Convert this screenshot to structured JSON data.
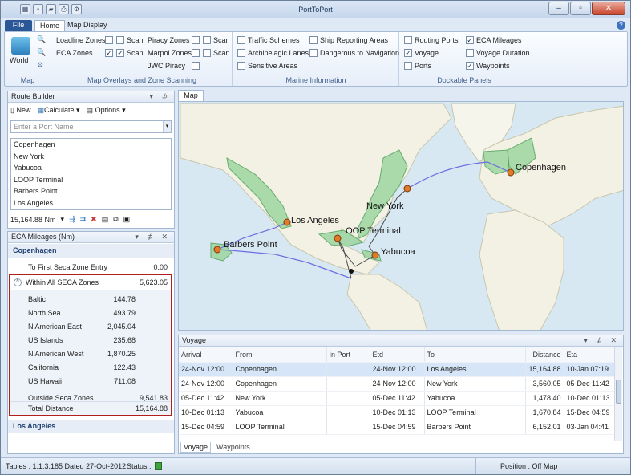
{
  "app": {
    "title": "PortToPort"
  },
  "tabs": {
    "file": "File",
    "home": "Home",
    "map_display": "Map Display"
  },
  "ribbon": {
    "map_group": {
      "world": "World",
      "name": "Map"
    },
    "overlays": {
      "name": "Map Overlays and Zone Scanning",
      "loadline": "Loadline Zones",
      "eca": "ECA Zones",
      "piracy": "Piracy Zones",
      "marpol": "Marpol Zones",
      "jwc": "JWC Piracy",
      "scan": "Scan"
    },
    "marine": {
      "name": "Marine Information",
      "traffic": "Traffic Schemes",
      "archipelagic": "Archipelagic Lanes",
      "sensitive": "Sensitive Areas",
      "ship_reporting": "Ship Reporting Areas",
      "dangerous": "Dangerous to Navigation"
    },
    "dockable": {
      "name": "Dockable Panels",
      "routing_ports": "Routing Ports",
      "voyage": "Voyage",
      "ports": "Ports",
      "eca_mileages": "ECA Mileages",
      "voyage_duration": "Voyage Duration",
      "waypoints": "Waypoints"
    }
  },
  "route_builder": {
    "title": "Route Builder",
    "new": "New",
    "calculate": "Calculate",
    "options": "Options",
    "placeholder": "Enter a Port Name",
    "ports": [
      "Copenhagen",
      "New York",
      "Yabucoa",
      "LOOP Terminal",
      "Barbers Point",
      "Los Angeles"
    ],
    "distance": "15,164.88 Nm"
  },
  "eca": {
    "title": "ECA Mileages (Nm)",
    "origin": "Copenhagen",
    "first_entry_label": "To First Seca Zone Entry",
    "first_entry_value": "0.00",
    "within_label": "Within All SECA Zones",
    "within_value": "5,623.05",
    "zones": [
      {
        "name": "Baltic",
        "value": "144.78"
      },
      {
        "name": "North Sea",
        "value": "493.79"
      },
      {
        "name": "N American East",
        "value": "2,045.04"
      },
      {
        "name": "US Islands",
        "value": "235.68"
      },
      {
        "name": "N American West",
        "value": "1,870.25"
      },
      {
        "name": "California",
        "value": "122.43"
      },
      {
        "name": "US Hawaii",
        "value": "711.08"
      }
    ],
    "outside_label": "Outside Seca Zones",
    "outside_value": "9,541.83",
    "total_label": "Total Distance",
    "total_value": "15,164.88",
    "destination": "Los Angeles"
  },
  "map": {
    "tab": "Map",
    "labels": {
      "copenhagen": "Copenhagen",
      "new_york": "New York",
      "los_angeles": "Los Angeles",
      "loop": "LOOP Terminal",
      "barbers": "Barbers Point",
      "yabucoa": "Yabucoa"
    }
  },
  "voyage": {
    "title": "Voyage",
    "columns": [
      "Arrival",
      "From",
      "In Port",
      "Etd",
      "To",
      "Distance",
      "Eta"
    ],
    "rows": [
      [
        "24-Nov 12:00",
        "Copenhagen",
        "",
        "24-Nov 12:00",
        "Los Angeles",
        "15,164.88",
        "10-Jan 07:19"
      ],
      [
        "24-Nov 12:00",
        "Copenhagen",
        "",
        "24-Nov 12:00",
        "New York",
        "3,560.05",
        "05-Dec 11:42"
      ],
      [
        "05-Dec 11:42",
        "New York",
        "",
        "05-Dec 11:42",
        "Yabucoa",
        "1,478.40",
        "10-Dec 01:13"
      ],
      [
        "10-Dec 01:13",
        "Yabucoa",
        "",
        "10-Dec 01:13",
        "LOOP Terminal",
        "1,670.84",
        "15-Dec 04:59"
      ],
      [
        "15-Dec 04:59",
        "LOOP Terminal",
        "",
        "15-Dec 04:59",
        "Barbers Point",
        "6,152.01",
        "03-Jan 04:41"
      ]
    ],
    "bottom_tabs": [
      "Voyage",
      "Waypoints"
    ]
  },
  "status": {
    "tables": "Tables : 1.1.3.185 Dated 27-Oct-2012",
    "status_label": "Status :",
    "position": "Position : Off Map"
  }
}
